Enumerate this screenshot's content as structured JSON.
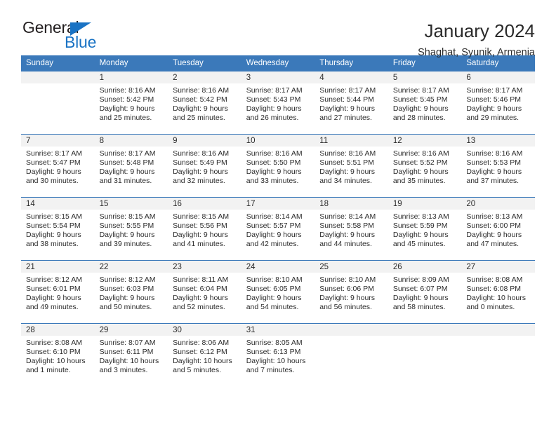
{
  "brand": {
    "name_top": "General",
    "name_bottom": "Blue",
    "accent_color": "#1a73c4"
  },
  "header": {
    "title": "January 2024",
    "subtitle": "Shaghat, Syunik, Armenia"
  },
  "calendar": {
    "header_bg": "#3b79ba",
    "daynum_bg": "#f2f2f2",
    "weekday_headers": [
      "Sunday",
      "Monday",
      "Tuesday",
      "Wednesday",
      "Thursday",
      "Friday",
      "Saturday"
    ],
    "labels": {
      "sunrise_prefix": "Sunrise:",
      "sunset_prefix": "Sunset:",
      "daylight_prefix": "Daylight:"
    },
    "weeks": [
      [
        {
          "day": "",
          "empty": true
        },
        {
          "day": "1",
          "sunrise": "Sunrise: 8:16 AM",
          "sunset": "Sunset: 5:42 PM",
          "daylight_1": "Daylight: 9 hours",
          "daylight_2": "and 25 minutes."
        },
        {
          "day": "2",
          "sunrise": "Sunrise: 8:16 AM",
          "sunset": "Sunset: 5:42 PM",
          "daylight_1": "Daylight: 9 hours",
          "daylight_2": "and 25 minutes."
        },
        {
          "day": "3",
          "sunrise": "Sunrise: 8:17 AM",
          "sunset": "Sunset: 5:43 PM",
          "daylight_1": "Daylight: 9 hours",
          "daylight_2": "and 26 minutes."
        },
        {
          "day": "4",
          "sunrise": "Sunrise: 8:17 AM",
          "sunset": "Sunset: 5:44 PM",
          "daylight_1": "Daylight: 9 hours",
          "daylight_2": "and 27 minutes."
        },
        {
          "day": "5",
          "sunrise": "Sunrise: 8:17 AM",
          "sunset": "Sunset: 5:45 PM",
          "daylight_1": "Daylight: 9 hours",
          "daylight_2": "and 28 minutes."
        },
        {
          "day": "6",
          "sunrise": "Sunrise: 8:17 AM",
          "sunset": "Sunset: 5:46 PM",
          "daylight_1": "Daylight: 9 hours",
          "daylight_2": "and 29 minutes."
        }
      ],
      [
        {
          "day": "7",
          "sunrise": "Sunrise: 8:17 AM",
          "sunset": "Sunset: 5:47 PM",
          "daylight_1": "Daylight: 9 hours",
          "daylight_2": "and 30 minutes."
        },
        {
          "day": "8",
          "sunrise": "Sunrise: 8:17 AM",
          "sunset": "Sunset: 5:48 PM",
          "daylight_1": "Daylight: 9 hours",
          "daylight_2": "and 31 minutes."
        },
        {
          "day": "9",
          "sunrise": "Sunrise: 8:16 AM",
          "sunset": "Sunset: 5:49 PM",
          "daylight_1": "Daylight: 9 hours",
          "daylight_2": "and 32 minutes."
        },
        {
          "day": "10",
          "sunrise": "Sunrise: 8:16 AM",
          "sunset": "Sunset: 5:50 PM",
          "daylight_1": "Daylight: 9 hours",
          "daylight_2": "and 33 minutes."
        },
        {
          "day": "11",
          "sunrise": "Sunrise: 8:16 AM",
          "sunset": "Sunset: 5:51 PM",
          "daylight_1": "Daylight: 9 hours",
          "daylight_2": "and 34 minutes."
        },
        {
          "day": "12",
          "sunrise": "Sunrise: 8:16 AM",
          "sunset": "Sunset: 5:52 PM",
          "daylight_1": "Daylight: 9 hours",
          "daylight_2": "and 35 minutes."
        },
        {
          "day": "13",
          "sunrise": "Sunrise: 8:16 AM",
          "sunset": "Sunset: 5:53 PM",
          "daylight_1": "Daylight: 9 hours",
          "daylight_2": "and 37 minutes."
        }
      ],
      [
        {
          "day": "14",
          "sunrise": "Sunrise: 8:15 AM",
          "sunset": "Sunset: 5:54 PM",
          "daylight_1": "Daylight: 9 hours",
          "daylight_2": "and 38 minutes."
        },
        {
          "day": "15",
          "sunrise": "Sunrise: 8:15 AM",
          "sunset": "Sunset: 5:55 PM",
          "daylight_1": "Daylight: 9 hours",
          "daylight_2": "and 39 minutes."
        },
        {
          "day": "16",
          "sunrise": "Sunrise: 8:15 AM",
          "sunset": "Sunset: 5:56 PM",
          "daylight_1": "Daylight: 9 hours",
          "daylight_2": "and 41 minutes."
        },
        {
          "day": "17",
          "sunrise": "Sunrise: 8:14 AM",
          "sunset": "Sunset: 5:57 PM",
          "daylight_1": "Daylight: 9 hours",
          "daylight_2": "and 42 minutes."
        },
        {
          "day": "18",
          "sunrise": "Sunrise: 8:14 AM",
          "sunset": "Sunset: 5:58 PM",
          "daylight_1": "Daylight: 9 hours",
          "daylight_2": "and 44 minutes."
        },
        {
          "day": "19",
          "sunrise": "Sunrise: 8:13 AM",
          "sunset": "Sunset: 5:59 PM",
          "daylight_1": "Daylight: 9 hours",
          "daylight_2": "and 45 minutes."
        },
        {
          "day": "20",
          "sunrise": "Sunrise: 8:13 AM",
          "sunset": "Sunset: 6:00 PM",
          "daylight_1": "Daylight: 9 hours",
          "daylight_2": "and 47 minutes."
        }
      ],
      [
        {
          "day": "21",
          "sunrise": "Sunrise: 8:12 AM",
          "sunset": "Sunset: 6:01 PM",
          "daylight_1": "Daylight: 9 hours",
          "daylight_2": "and 49 minutes."
        },
        {
          "day": "22",
          "sunrise": "Sunrise: 8:12 AM",
          "sunset": "Sunset: 6:03 PM",
          "daylight_1": "Daylight: 9 hours",
          "daylight_2": "and 50 minutes."
        },
        {
          "day": "23",
          "sunrise": "Sunrise: 8:11 AM",
          "sunset": "Sunset: 6:04 PM",
          "daylight_1": "Daylight: 9 hours",
          "daylight_2": "and 52 minutes."
        },
        {
          "day": "24",
          "sunrise": "Sunrise: 8:10 AM",
          "sunset": "Sunset: 6:05 PM",
          "daylight_1": "Daylight: 9 hours",
          "daylight_2": "and 54 minutes."
        },
        {
          "day": "25",
          "sunrise": "Sunrise: 8:10 AM",
          "sunset": "Sunset: 6:06 PM",
          "daylight_1": "Daylight: 9 hours",
          "daylight_2": "and 56 minutes."
        },
        {
          "day": "26",
          "sunrise": "Sunrise: 8:09 AM",
          "sunset": "Sunset: 6:07 PM",
          "daylight_1": "Daylight: 9 hours",
          "daylight_2": "and 58 minutes."
        },
        {
          "day": "27",
          "sunrise": "Sunrise: 8:08 AM",
          "sunset": "Sunset: 6:08 PM",
          "daylight_1": "Daylight: 10 hours",
          "daylight_2": "and 0 minutes."
        }
      ],
      [
        {
          "day": "28",
          "sunrise": "Sunrise: 8:08 AM",
          "sunset": "Sunset: 6:10 PM",
          "daylight_1": "Daylight: 10 hours",
          "daylight_2": "and 1 minute."
        },
        {
          "day": "29",
          "sunrise": "Sunrise: 8:07 AM",
          "sunset": "Sunset: 6:11 PM",
          "daylight_1": "Daylight: 10 hours",
          "daylight_2": "and 3 minutes."
        },
        {
          "day": "30",
          "sunrise": "Sunrise: 8:06 AM",
          "sunset": "Sunset: 6:12 PM",
          "daylight_1": "Daylight: 10 hours",
          "daylight_2": "and 5 minutes."
        },
        {
          "day": "31",
          "sunrise": "Sunrise: 8:05 AM",
          "sunset": "Sunset: 6:13 PM",
          "daylight_1": "Daylight: 10 hours",
          "daylight_2": "and 7 minutes."
        },
        {
          "day": "",
          "empty": true
        },
        {
          "day": "",
          "empty": true
        },
        {
          "day": "",
          "empty": true
        }
      ]
    ]
  }
}
